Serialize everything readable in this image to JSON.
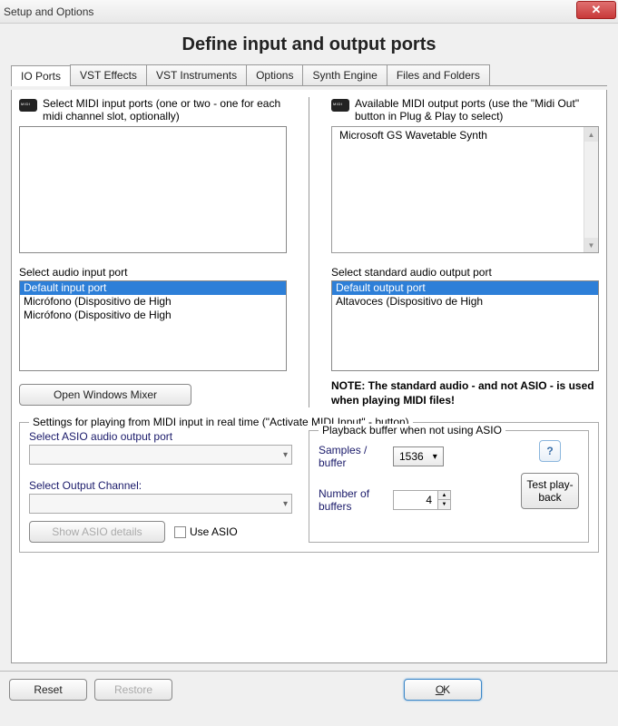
{
  "window": {
    "title": "Setup and Options"
  },
  "page": {
    "heading": "Define input and output ports"
  },
  "tabs": {
    "items": [
      "IO Ports",
      "VST Effects",
      "VST Instruments",
      "Options",
      "Synth Engine",
      "Files and Folders"
    ],
    "active_index": 0
  },
  "midi_input": {
    "label": "Select MIDI input ports (one or two - one for each midi channel slot, optionally)",
    "items": []
  },
  "midi_output": {
    "label": "Available MIDI output ports (use the \"Midi Out\" button in Plug & Play to select)",
    "items": [
      "Microsoft GS Wavetable Synth"
    ]
  },
  "audio_input": {
    "label": "Select audio input port",
    "items": [
      "Default input port",
      "Micrófono (Dispositivo de High",
      "Micrófono (Dispositivo de High"
    ],
    "selected_index": 0
  },
  "audio_output": {
    "label": "Select standard audio output port",
    "items": [
      "Default output port",
      "Altavoces (Dispositivo de High"
    ],
    "selected_index": 0
  },
  "open_mixer_label": "Open Windows Mixer",
  "note": "NOTE: The standard audio - and not ASIO - is used when playing MIDI files!",
  "realtime": {
    "legend": "Settings for playing from MIDI input in real time (\"Activate MIDI Input\" - button)",
    "asio_port_label": "Select ASIO audio output port",
    "output_channel_label": "Select Output Channel:",
    "show_asio_label": "Show ASIO details",
    "use_asio_label": "Use ASIO",
    "buffer_legend": "Playback buffer when not using ASIO",
    "samples_label": "Samples / buffer",
    "samples_value": "1536",
    "num_buffers_label": "Number of buffers",
    "num_buffers_value": "4",
    "test_label": "Test play-back"
  },
  "buttons": {
    "reset": "Reset",
    "restore": "Restore",
    "ok": "OK"
  }
}
